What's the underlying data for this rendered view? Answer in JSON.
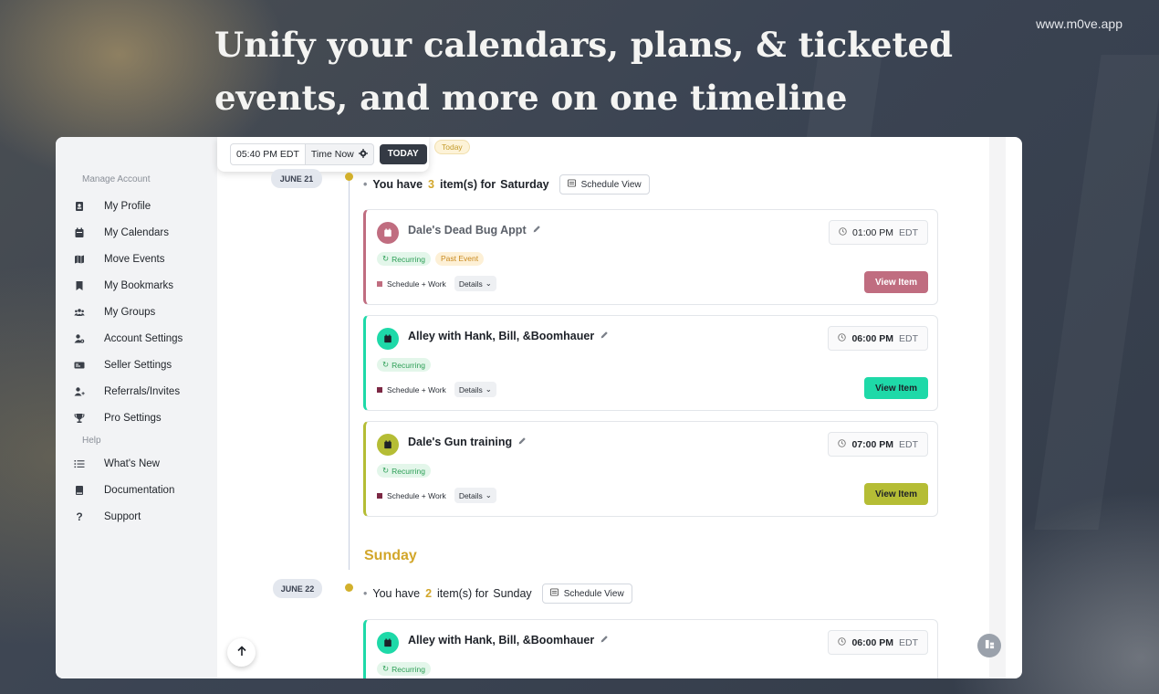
{
  "url": "www.m0ve.app",
  "headline": {
    "line1": "Unify your calendars, plans, & ticketed",
    "line2": "events, and more on one timeline"
  },
  "sidebar": {
    "manage_label": "Manage Account",
    "help_label": "Help",
    "items": [
      {
        "label": "My Profile",
        "icon": "profile-icon"
      },
      {
        "label": "My Calendars",
        "icon": "calendar-icon"
      },
      {
        "label": "Move Events",
        "icon": "map-icon"
      },
      {
        "label": "My Bookmarks",
        "icon": "bookmark-icon"
      },
      {
        "label": "My Groups",
        "icon": "groups-icon"
      },
      {
        "label": "Account Settings",
        "icon": "user-gear-icon"
      },
      {
        "label": "Seller Settings",
        "icon": "id-card-icon"
      },
      {
        "label": "Referrals/Invites",
        "icon": "user-plus-icon"
      },
      {
        "label": "Pro Settings",
        "icon": "trophy-icon"
      }
    ],
    "help_items": [
      {
        "label": "What's New",
        "icon": "list-icon"
      },
      {
        "label": "Documentation",
        "icon": "book-icon"
      },
      {
        "label": "Support",
        "icon": "question-icon"
      }
    ]
  },
  "timebar": {
    "time": "05:40 PM EDT",
    "time_now": "Time Now",
    "today_button": "TODAY"
  },
  "today_pill": "Today",
  "days": [
    {
      "date": "JUNE 21",
      "summary_prefix": "You have",
      "count": "3",
      "summary_mid": "item(s) for",
      "day_name": "Saturday",
      "schedule_view": "Schedule View",
      "items": [
        {
          "title": "Dale's Dead Bug Appt",
          "time": "01:00 PM",
          "tz": "EDT",
          "badges": [
            "Recurring",
            "Past Event"
          ],
          "category": "Schedule + Work",
          "details": "Details",
          "view": "View Item",
          "color": "#c06d80"
        },
        {
          "title": "Alley with Hank, Bill, &Boomhauer",
          "time": "06:00 PM",
          "tz": "EDT",
          "badges": [
            "Recurring"
          ],
          "category": "Schedule + Work",
          "details": "Details",
          "view": "View Item",
          "color": "#1ed9a8"
        },
        {
          "title": "Dale's Gun training",
          "time": "07:00 PM",
          "tz": "EDT",
          "badges": [
            "Recurring"
          ],
          "category": "Schedule + Work",
          "details": "Details",
          "view": "View Item",
          "color": "#b5bd35"
        }
      ]
    },
    {
      "day_title": "Sunday",
      "date": "JUNE 22",
      "summary_prefix": "You have",
      "count": "2",
      "summary_mid": "item(s) for",
      "day_name": "Sunday",
      "schedule_view": "Schedule View",
      "items": [
        {
          "title": "Alley with Hank, Bill, &Boomhauer",
          "time": "06:00 PM",
          "tz": "EDT",
          "badges": [
            "Recurring"
          ],
          "color": "#1ed9a8"
        }
      ]
    }
  ]
}
